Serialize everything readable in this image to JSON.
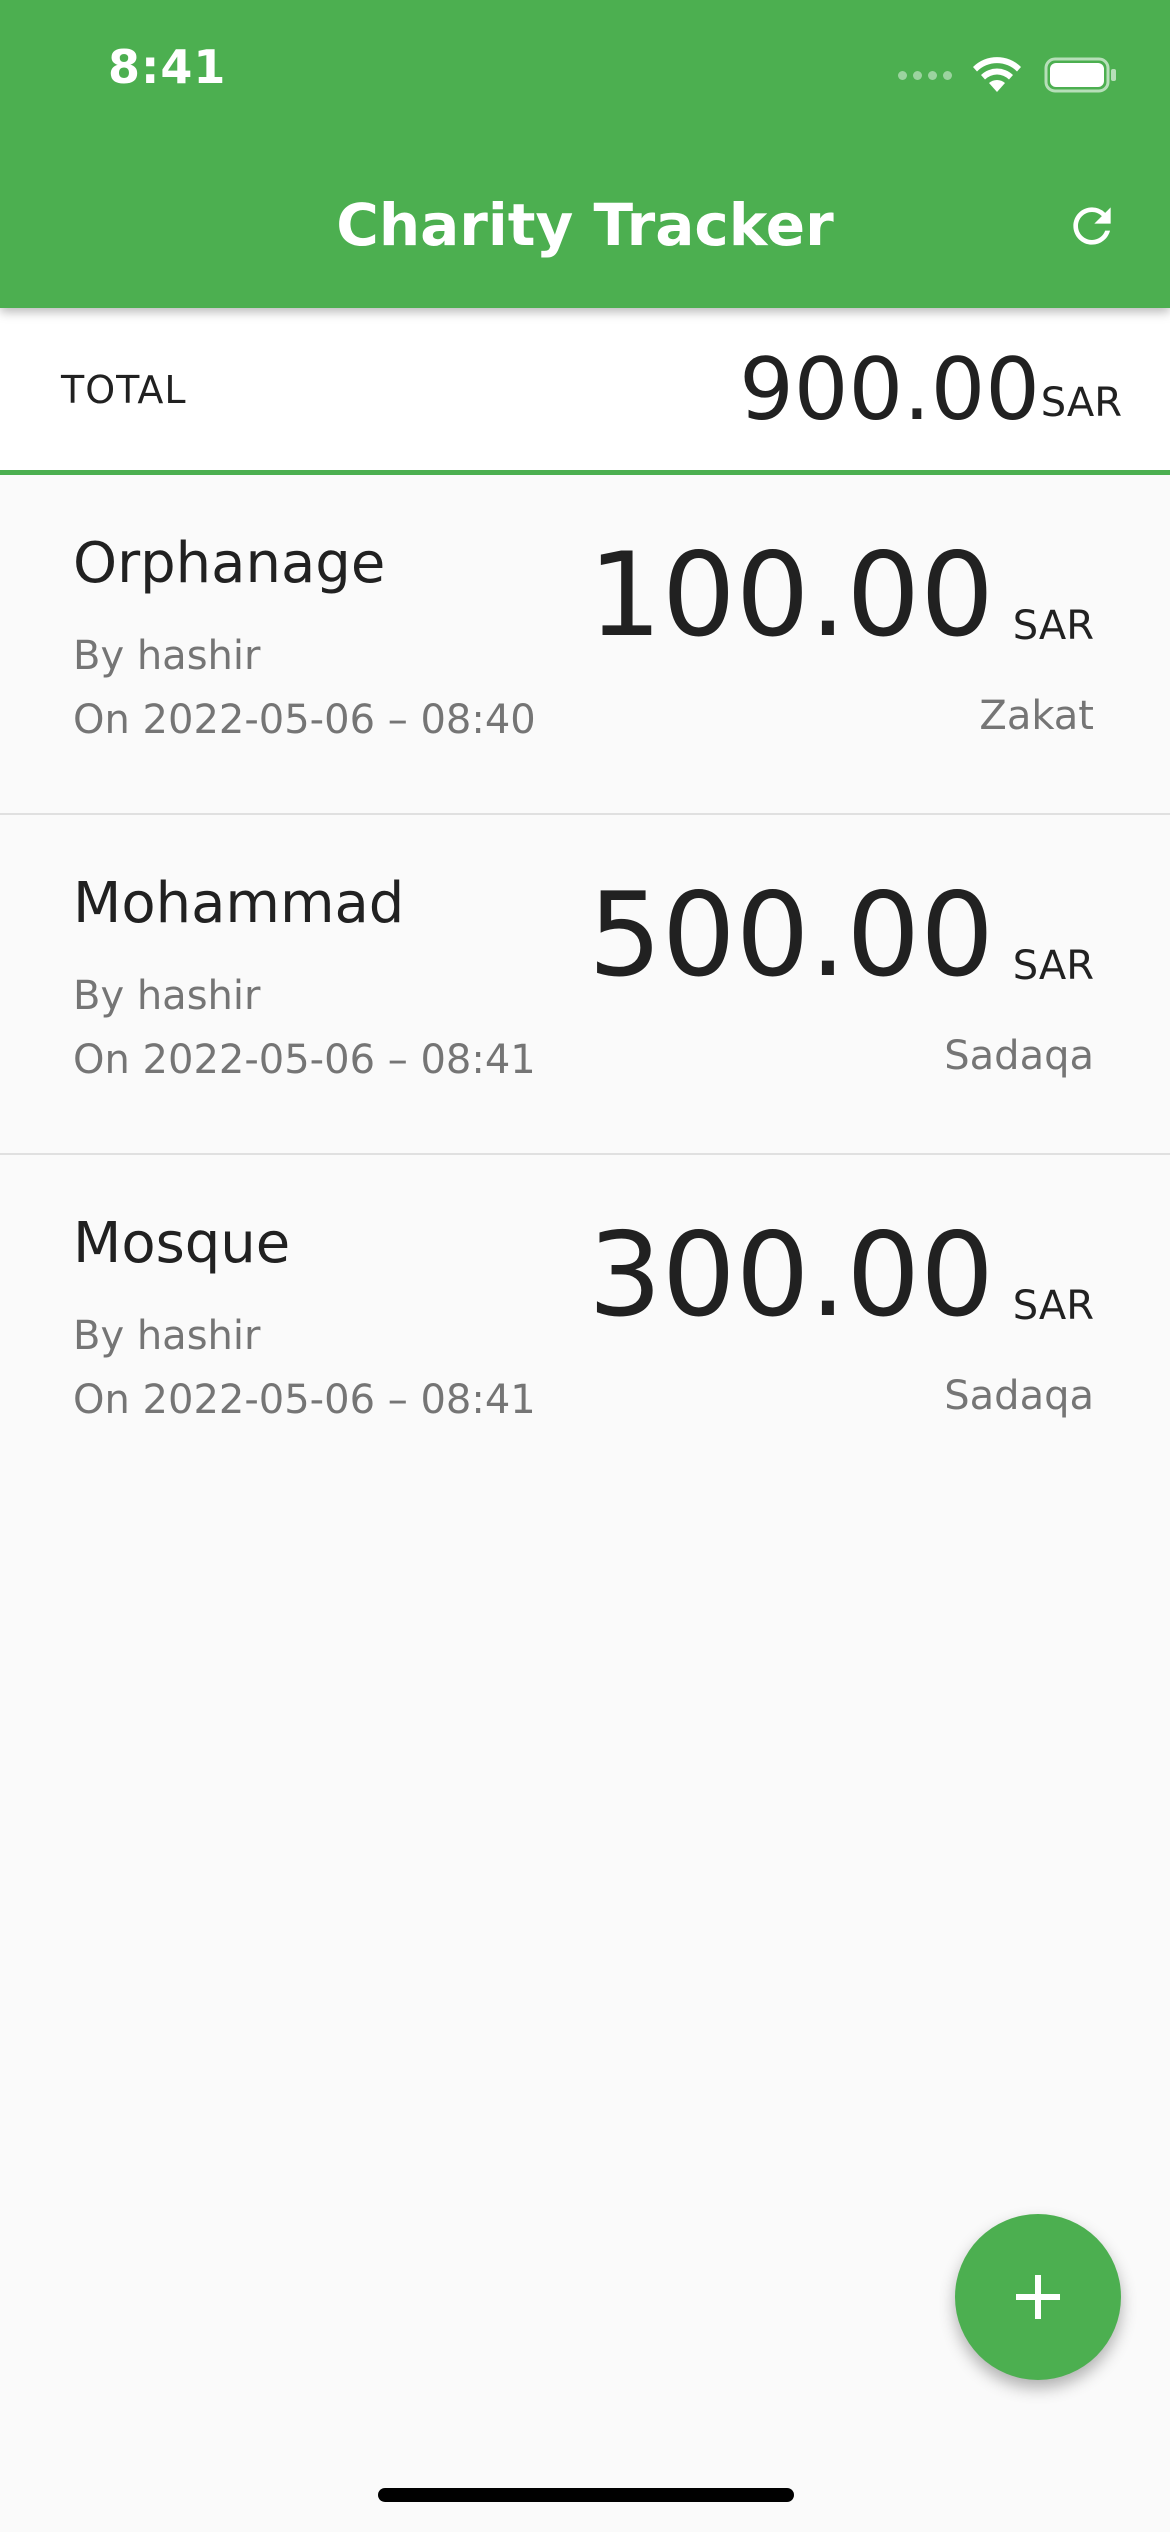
{
  "status_bar": {
    "time": "8:41"
  },
  "app_bar": {
    "title": "Charity Tracker",
    "action_icon": "refresh-icon",
    "color": "#4caf50"
  },
  "summary": {
    "label": "TOTAL",
    "amount": "900.00",
    "currency": "SAR"
  },
  "donations": [
    {
      "name": "Orphanage",
      "by": "By hashir",
      "on": "On 2022-05-06 – 08:40",
      "amount": "100.00",
      "currency": "SAR",
      "category": "Zakat"
    },
    {
      "name": "Mohammad",
      "by": "By hashir",
      "on": "On 2022-05-06 – 08:41",
      "amount": "500.00",
      "currency": "SAR",
      "category": "Sadaqa"
    },
    {
      "name": "Mosque",
      "by": "By hashir",
      "on": "On 2022-05-06 – 08:41",
      "amount": "300.00",
      "currency": "SAR",
      "category": "Sadaqa"
    }
  ],
  "fab": {
    "icon": "plus-icon"
  }
}
